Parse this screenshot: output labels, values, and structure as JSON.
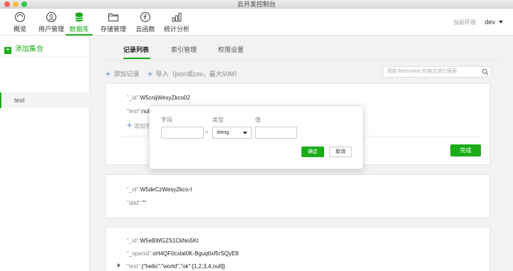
{
  "window": {
    "title": "云开发控制台"
  },
  "nav": {
    "items": [
      {
        "label": "概览",
        "icon": "gauge-icon"
      },
      {
        "label": "用户管理",
        "icon": "user-icon"
      },
      {
        "label": "数据库",
        "icon": "database-icon"
      },
      {
        "label": "存储管理",
        "icon": "folder-icon"
      },
      {
        "label": "云函数",
        "icon": "function-icon"
      },
      {
        "label": "统计分析",
        "icon": "chart-icon"
      }
    ],
    "active_index": 2,
    "env_label": "当前环境:",
    "env_value": "dev"
  },
  "sidebar": {
    "add_collection": "添加集合",
    "collections": [
      "test"
    ]
  },
  "tabs": [
    "记录列表",
    "索引管理",
    "权限设置"
  ],
  "actions": {
    "add_record": "添加记录",
    "import": "导入（json或csv，最大50M）",
    "search_placeholder": "请按 field:value 的格式进行搜索"
  },
  "records": [
    {
      "id_key": "\"_id\":",
      "id_value": "W5cnijWesyZkco02",
      "fields": [
        {
          "key": "\"test\":",
          "value": "nul"
        }
      ],
      "add_field": "添加字",
      "done_label": "完成"
    },
    {
      "id_key": "\"_id\":",
      "id_value": "W5deCzWesyZkco-I",
      "fields": [
        {
          "key": "\"ddd\":",
          "value": "\"\""
        }
      ]
    },
    {
      "id_key": "\"_id\":",
      "id_value": "W5eBWG2S1CkNo5Kt",
      "fields": [
        {
          "key": "\"_openid\":",
          "value": "oH4QF0cxlal0K-Bguq0xf5rSQyE8"
        },
        {
          "key": "\"test\":",
          "value": "{\"hello\":\"world\",\"ok\":[1,2,3,4,null]}"
        }
      ]
    }
  ],
  "popover": {
    "field_label": "字段",
    "type_label": "类型",
    "value_label": "值",
    "equals": "=",
    "type_value": "string",
    "ok_label": "确定",
    "cancel_label": "取消"
  },
  "colors": {
    "accent": "#1aad19",
    "link": "#5a7bd8"
  }
}
